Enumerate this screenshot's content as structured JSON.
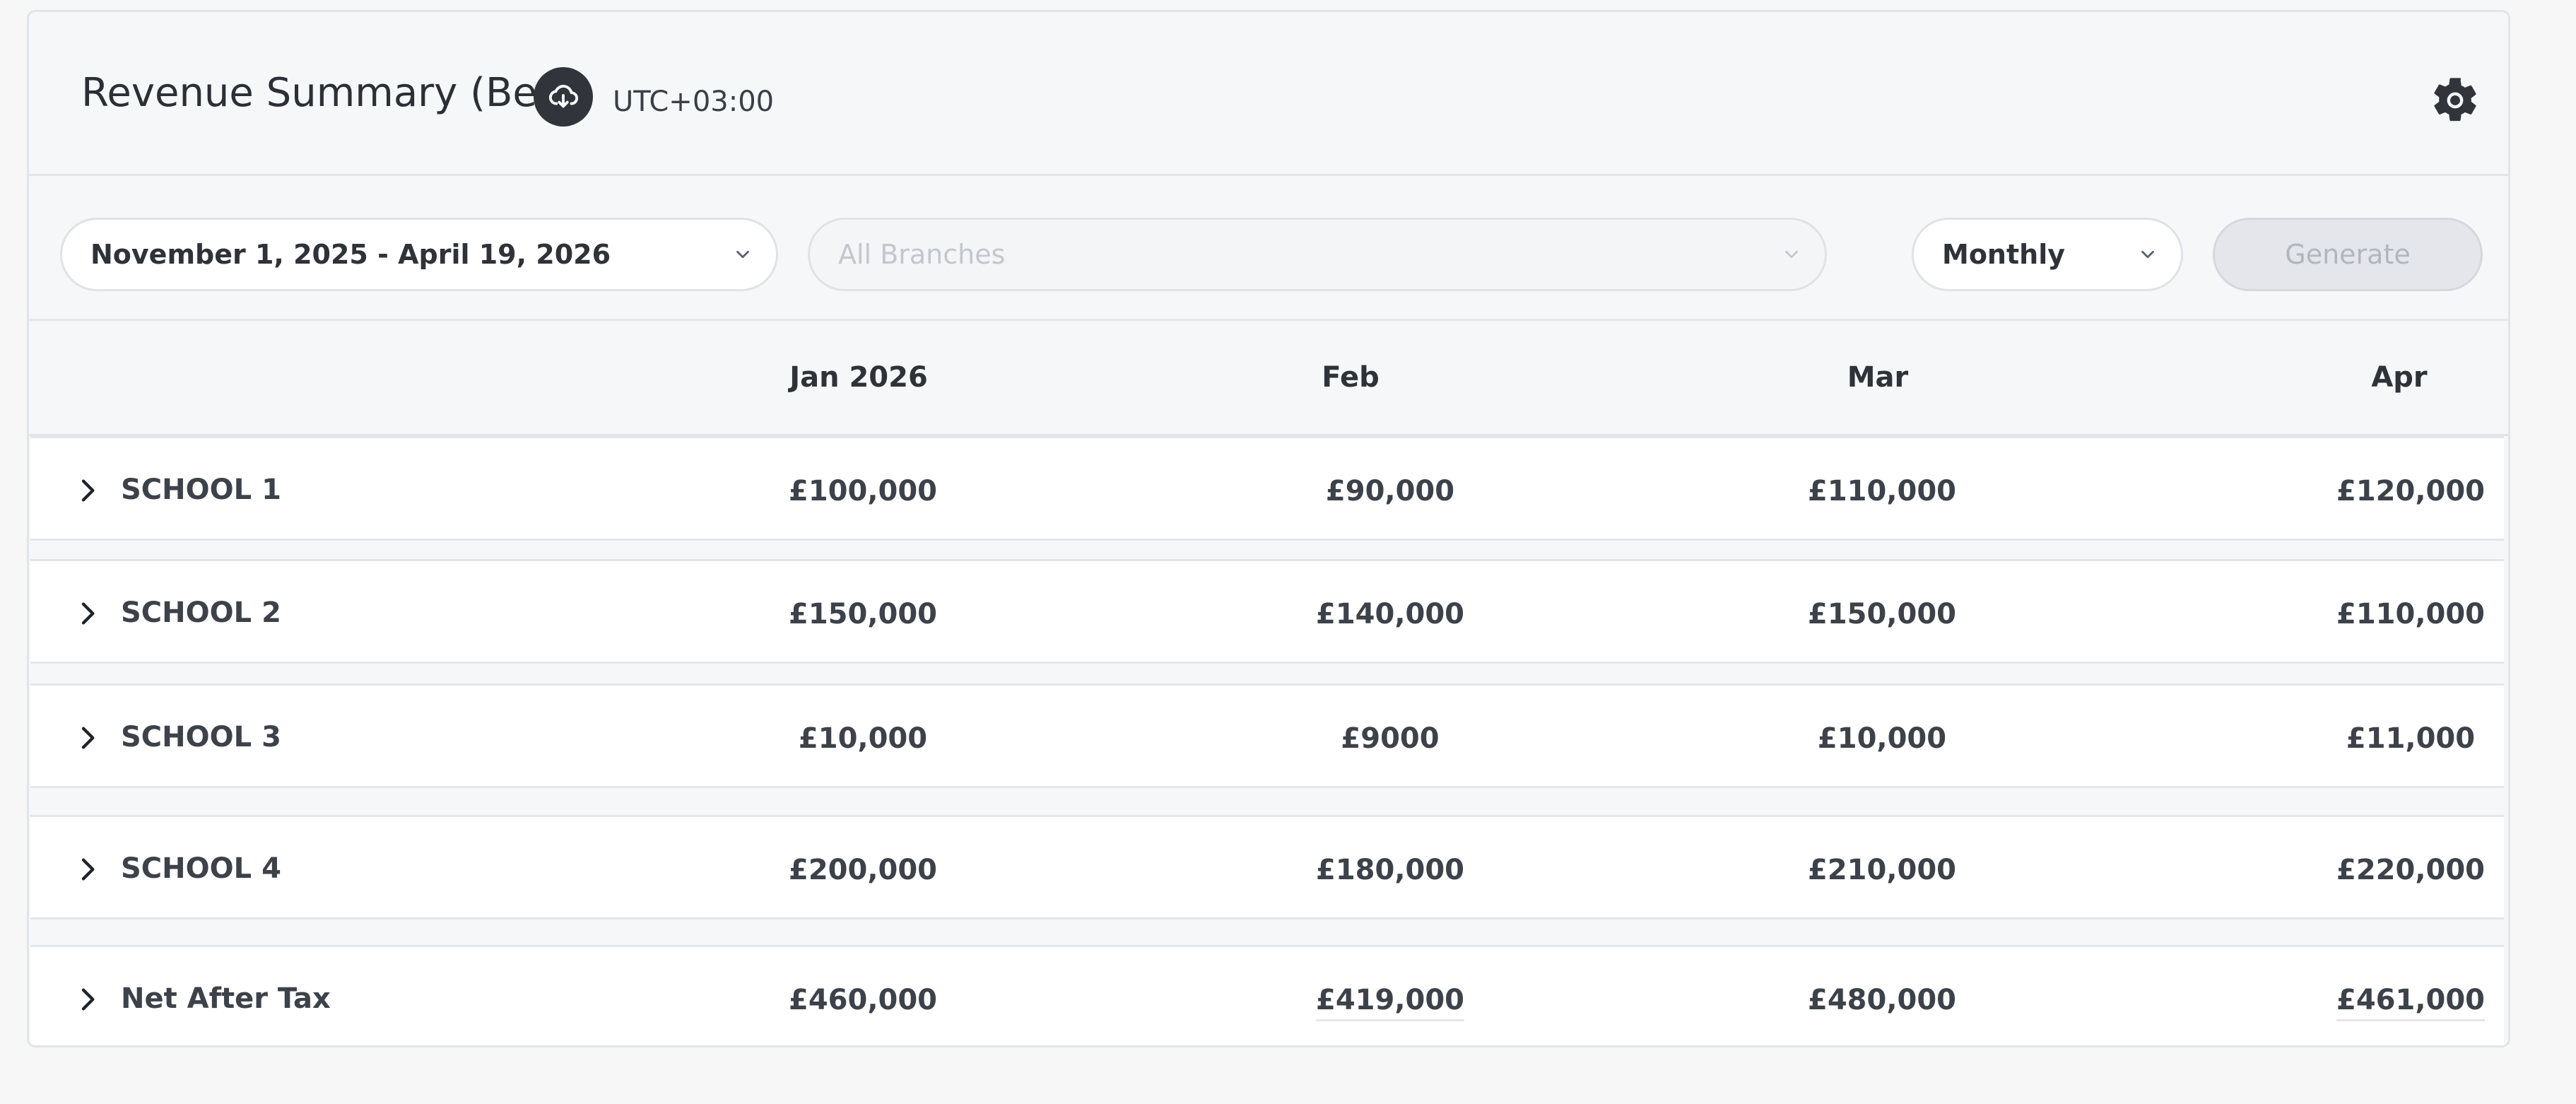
{
  "header": {
    "title": "Revenue Summary (Beta)",
    "timezone": "UTC+03:00",
    "download_icon": "cloud-download-icon",
    "settings_icon": "gear-icon"
  },
  "filters": {
    "date_range": "November 1, 2025 - April 19, 2026",
    "branches_placeholder": "All Branches",
    "period": "Monthly",
    "generate_label": "Generate"
  },
  "table": {
    "columns": [
      "Jan 2026",
      "Feb",
      "Mar",
      "Apr"
    ],
    "rows": [
      {
        "label": "SCHOOL 1",
        "values": [
          "£100,000",
          "£90,000",
          "£110,000",
          "£120,000"
        ]
      },
      {
        "label": "SCHOOL 2",
        "values": [
          "£150,000",
          "£140,000",
          "£150,000",
          "£110,000"
        ]
      },
      {
        "label": "SCHOOL 3",
        "values": [
          "£10,000",
          "£9000",
          "£10,000",
          "£11,000"
        ]
      },
      {
        "label": "SCHOOL 4",
        "values": [
          "£200,000",
          "£180,000",
          "£210,000",
          "£220,000"
        ]
      },
      {
        "label": "Net After Tax",
        "values": [
          "£460,000",
          "£419,000",
          "£480,000",
          "£461,000"
        ]
      }
    ]
  },
  "colors": {
    "background": "#f6f7f9",
    "text": "#3d424a",
    "icon_dark": "#31353b",
    "disabled_button": "#e4e6eb"
  }
}
